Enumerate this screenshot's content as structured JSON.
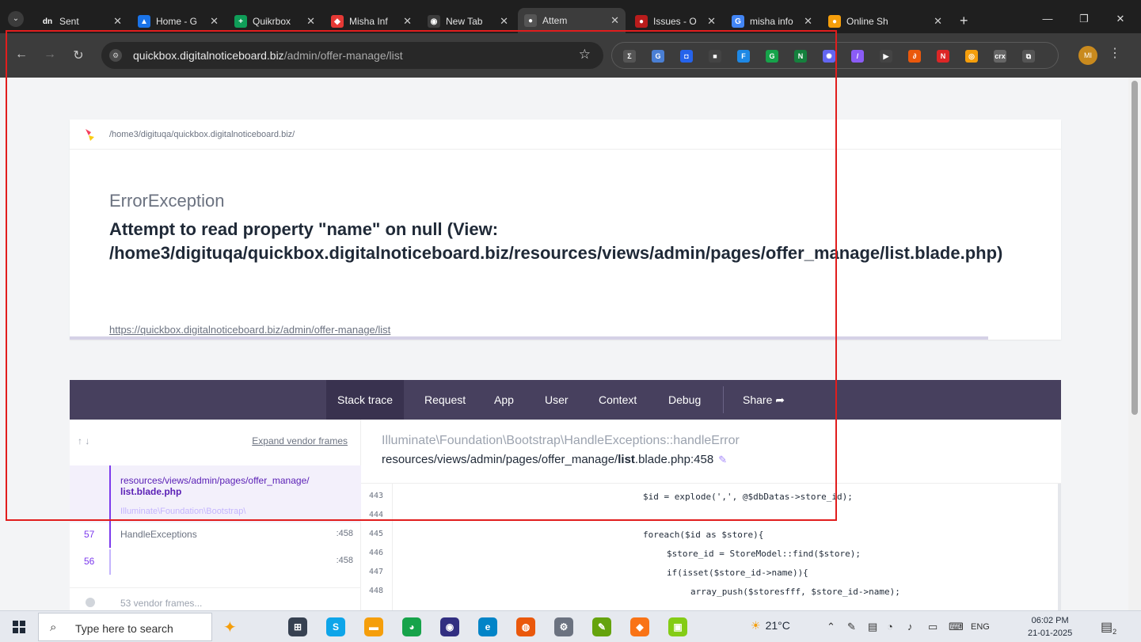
{
  "browser": {
    "tabs": [
      {
        "title": "Sent",
        "fav": "dn",
        "color": "#1f1f1f"
      },
      {
        "title": "Home - G",
        "fav": "▲",
        "color": "#1a73e8"
      },
      {
        "title": "Quikrbox",
        "fav": "+",
        "color": "#0f9d58"
      },
      {
        "title": "Misha Inf",
        "fav": "◆",
        "color": "#e53935"
      },
      {
        "title": "New Tab",
        "fav": "◉",
        "color": "#3c3c3c"
      },
      {
        "title": "Attem",
        "fav": "●",
        "color": "#555"
      },
      {
        "title": "Issues - O",
        "fav": "●",
        "color": "#b91c1c"
      },
      {
        "title": "misha info",
        "fav": "G",
        "color": "#4285f4"
      },
      {
        "title": "Online Sh",
        "fav": "●",
        "color": "#f59e0b"
      }
    ],
    "url_host": "quickbox.digitalnoticeboard.biz",
    "url_path": "/admin/offer-manage/list",
    "extensions": [
      {
        "label": "Σ",
        "color": "#555"
      },
      {
        "label": "G",
        "color": "#4a7fd4"
      },
      {
        "label": "◘",
        "color": "#2563eb"
      },
      {
        "label": "■",
        "color": "#444"
      },
      {
        "label": "F",
        "color": "#1e88e5"
      },
      {
        "label": "G",
        "color": "#16a34a"
      },
      {
        "label": "N",
        "color": "#15803d"
      },
      {
        "label": "✺",
        "color": "#6366f1"
      },
      {
        "label": "/",
        "color": "#8b5cf6"
      },
      {
        "label": "▶",
        "color": "#444"
      },
      {
        "label": "∂",
        "color": "#ea580c"
      },
      {
        "label": "N",
        "color": "#dc2626"
      },
      {
        "label": "◎",
        "color": "#f59e0b"
      },
      {
        "label": "crx",
        "color": "#666"
      },
      {
        "label": "⧉",
        "color": "#555"
      }
    ]
  },
  "error": {
    "path": "/home3/digituqa/quickbox.digitalnoticeboard.biz/",
    "exception_class": "ErrorException",
    "message_line1": "Attempt to read property \"name\" on null (View:",
    "message_line2": "/home3/digituqa/quickbox.digitalnoticeboard.biz/resources/views/admin/pages/offer_manage/list.blade.php)",
    "url": "https://quickbox.digitalnoticeboard.biz/admin/offer-manage/list"
  },
  "trace": {
    "nav": [
      "Stack trace",
      "Request",
      "App",
      "User",
      "Context",
      "Debug",
      "Share"
    ],
    "expand_label": "Expand vendor frames",
    "active_frame": {
      "dir": "resources/views/admin/pages/offer_manage/",
      "file": "list.blade.php",
      "ghost": "Illuminate\\Foundation\\Bootstrap\\"
    },
    "frames": [
      {
        "num": "57",
        "name": "HandleExceptions",
        "line": ":458"
      },
      {
        "num": "56",
        "name": "",
        "line": ":458"
      }
    ],
    "vendor_frames": "53 vendor frames...",
    "code_class": "Illuminate\\Foundation\\Bootstrap\\HandleExceptions::handleError",
    "code_file_prefix": "resources/views/admin/pages/offer_manage/",
    "code_file_bold": "list",
    "code_file_suffix": ".blade.php:458",
    "lines": [
      {
        "n": "443",
        "code": "$id = explode(',', @$dbDatas->store_id);",
        "indent": 1
      },
      {
        "n": "444",
        "code": "",
        "indent": 1
      },
      {
        "n": "445",
        "code": "foreach($id as $store){",
        "indent": 1
      },
      {
        "n": "446",
        "code": "$store_id = StoreModel::find($store);",
        "indent": 2
      },
      {
        "n": "447",
        "code": "if(isset($store_id->name)){",
        "indent": 2
      },
      {
        "n": "448",
        "code": "array_push($storesfff, $store_id->name);",
        "indent": 3
      }
    ]
  },
  "taskbar": {
    "search_placeholder": "Type here to search",
    "apps": [
      {
        "label": "⊞",
        "color": "#374151"
      },
      {
        "label": "S",
        "color": "#0ea5e9"
      },
      {
        "label": "▬",
        "color": "#f59e0b"
      },
      {
        "label": "◕",
        "color": "#16a34a"
      },
      {
        "label": "◉",
        "color": "#312e81"
      },
      {
        "label": "e",
        "color": "#0284c7"
      },
      {
        "label": "◍",
        "color": "#ea580c"
      },
      {
        "label": "⚙",
        "color": "#6b7280"
      },
      {
        "label": "✎",
        "color": "#65a30d"
      },
      {
        "label": "◆",
        "color": "#f97316"
      },
      {
        "label": "▣",
        "color": "#84cc16"
      }
    ],
    "weather": "21°C",
    "lang": "ENG",
    "time": "06:02 PM",
    "date": "21-01-2025",
    "notif_count": "2"
  }
}
